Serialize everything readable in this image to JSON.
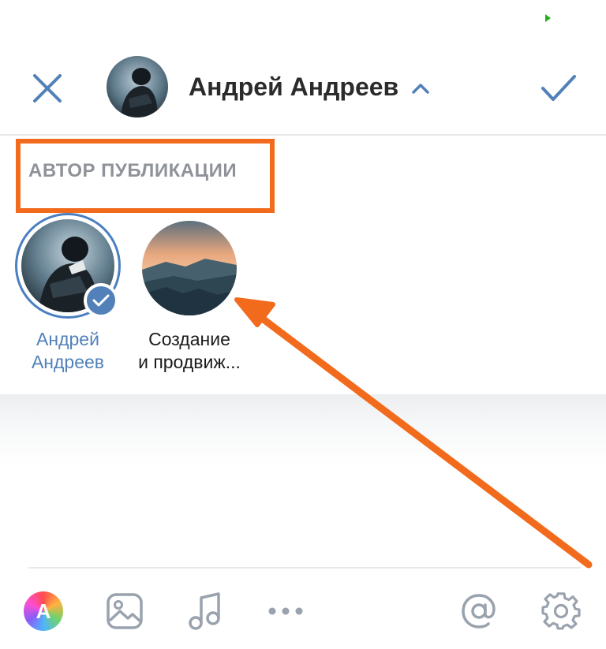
{
  "colors": {
    "accent": "#5181b8",
    "highlight": "#f26b1d",
    "icon": "#99a2ad",
    "status_dot": "#21b31f"
  },
  "header": {
    "close_icon": "close-icon",
    "user_name": "Андрей Андреев",
    "chevron_icon": "chevron-up-icon",
    "done_icon": "checkmark-icon"
  },
  "author_section": {
    "label": "АВТОР ПУБЛИКАЦИИ",
    "authors": [
      {
        "name_line1": "Андрей",
        "name_line2": "Андреев",
        "selected": true
      },
      {
        "name_line1": "Создание",
        "name_line2": "и продвиж...",
        "selected": false
      }
    ]
  },
  "toolbar": {
    "items": [
      {
        "icon": "text-style-icon",
        "letter": "A"
      },
      {
        "icon": "image-icon"
      },
      {
        "icon": "music-icon"
      },
      {
        "icon": "more-icon"
      },
      {
        "icon": "mention-icon"
      },
      {
        "icon": "settings-icon"
      }
    ]
  }
}
